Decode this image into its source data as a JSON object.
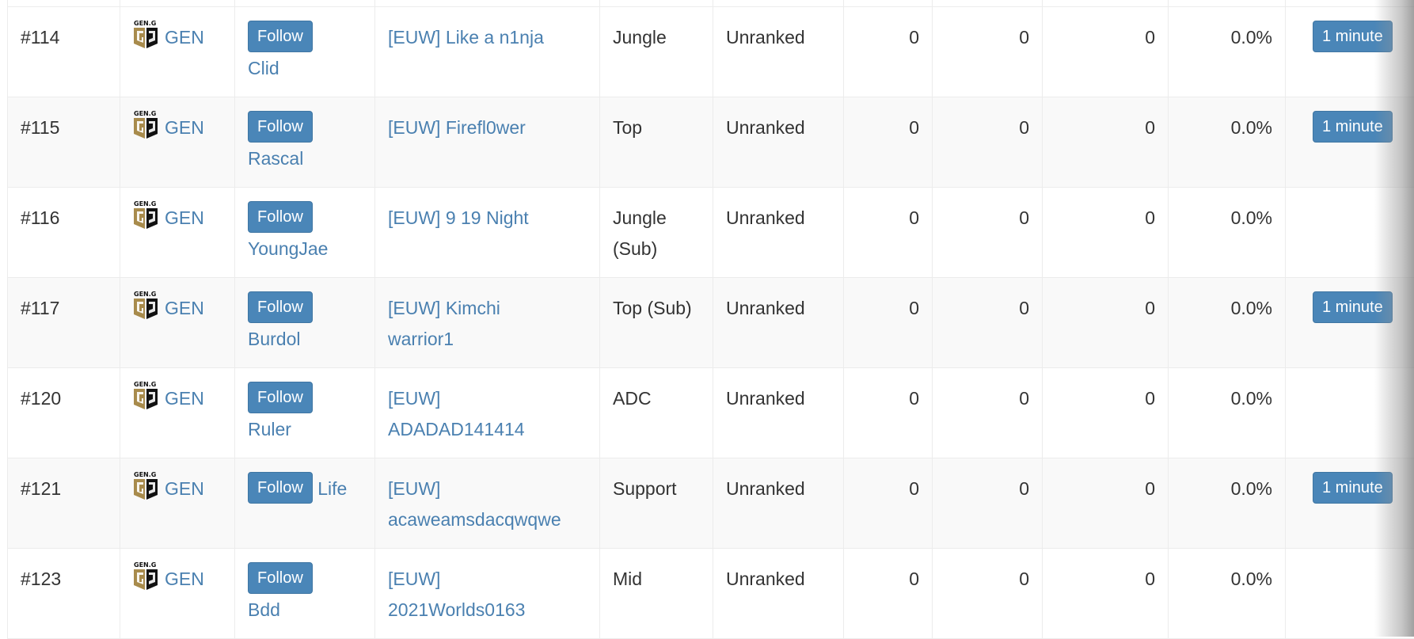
{
  "team_logo_text": "GEN.G",
  "colors": {
    "link": "#4a80b0",
    "button": "#4a86b8",
    "logo_gold": "#a88b4c",
    "logo_black": "#111111"
  },
  "follow_label": "Follow",
  "rows": [
    {
      "rank": "#114",
      "team": "GEN",
      "player": "Clid",
      "account": "[EUW] Like a n1nja",
      "role": "Jungle",
      "tier": "Unranked",
      "c1": "0",
      "c2": "0",
      "c3": "0",
      "winrate": "0.0%",
      "live": "1 minute"
    },
    {
      "rank": "#115",
      "team": "GEN",
      "player": "Rascal",
      "account": "[EUW] Firefl0wer",
      "role": "Top",
      "tier": "Unranked",
      "c1": "0",
      "c2": "0",
      "c3": "0",
      "winrate": "0.0%",
      "live": "1 minute"
    },
    {
      "rank": "#116",
      "team": "GEN",
      "player": "YoungJae",
      "account": "[EUW] 9 19 Night",
      "role": "Jungle (Sub)",
      "tier": "Unranked",
      "c1": "0",
      "c2": "0",
      "c3": "0",
      "winrate": "0.0%"
    },
    {
      "rank": "#117",
      "team": "GEN",
      "player": "Burdol",
      "account": "[EUW] Kimchi warrior1",
      "role": "Top (Sub)",
      "tier": "Unranked",
      "c1": "0",
      "c2": "0",
      "c3": "0",
      "winrate": "0.0%",
      "live": "1 minute"
    },
    {
      "rank": "#120",
      "team": "GEN",
      "player": "Ruler",
      "account": "[EUW] ADADAD141414",
      "role": "ADC",
      "tier": "Unranked",
      "c1": "0",
      "c2": "0",
      "c3": "0",
      "winrate": "0.0%"
    },
    {
      "rank": "#121",
      "team": "GEN",
      "player": "Life",
      "account": "[EUW] acaweamsdacqwqwe",
      "role": "Support",
      "tier": "Unranked",
      "c1": "0",
      "c2": "0",
      "c3": "0",
      "winrate": "0.0%",
      "live": "1 minute"
    },
    {
      "rank": "#123",
      "team": "GEN",
      "player": "Bdd",
      "account": "[EUW] 2021Worlds0163",
      "role": "Mid",
      "tier": "Unranked",
      "c1": "0",
      "c2": "0",
      "c3": "0",
      "winrate": "0.0%"
    }
  ]
}
